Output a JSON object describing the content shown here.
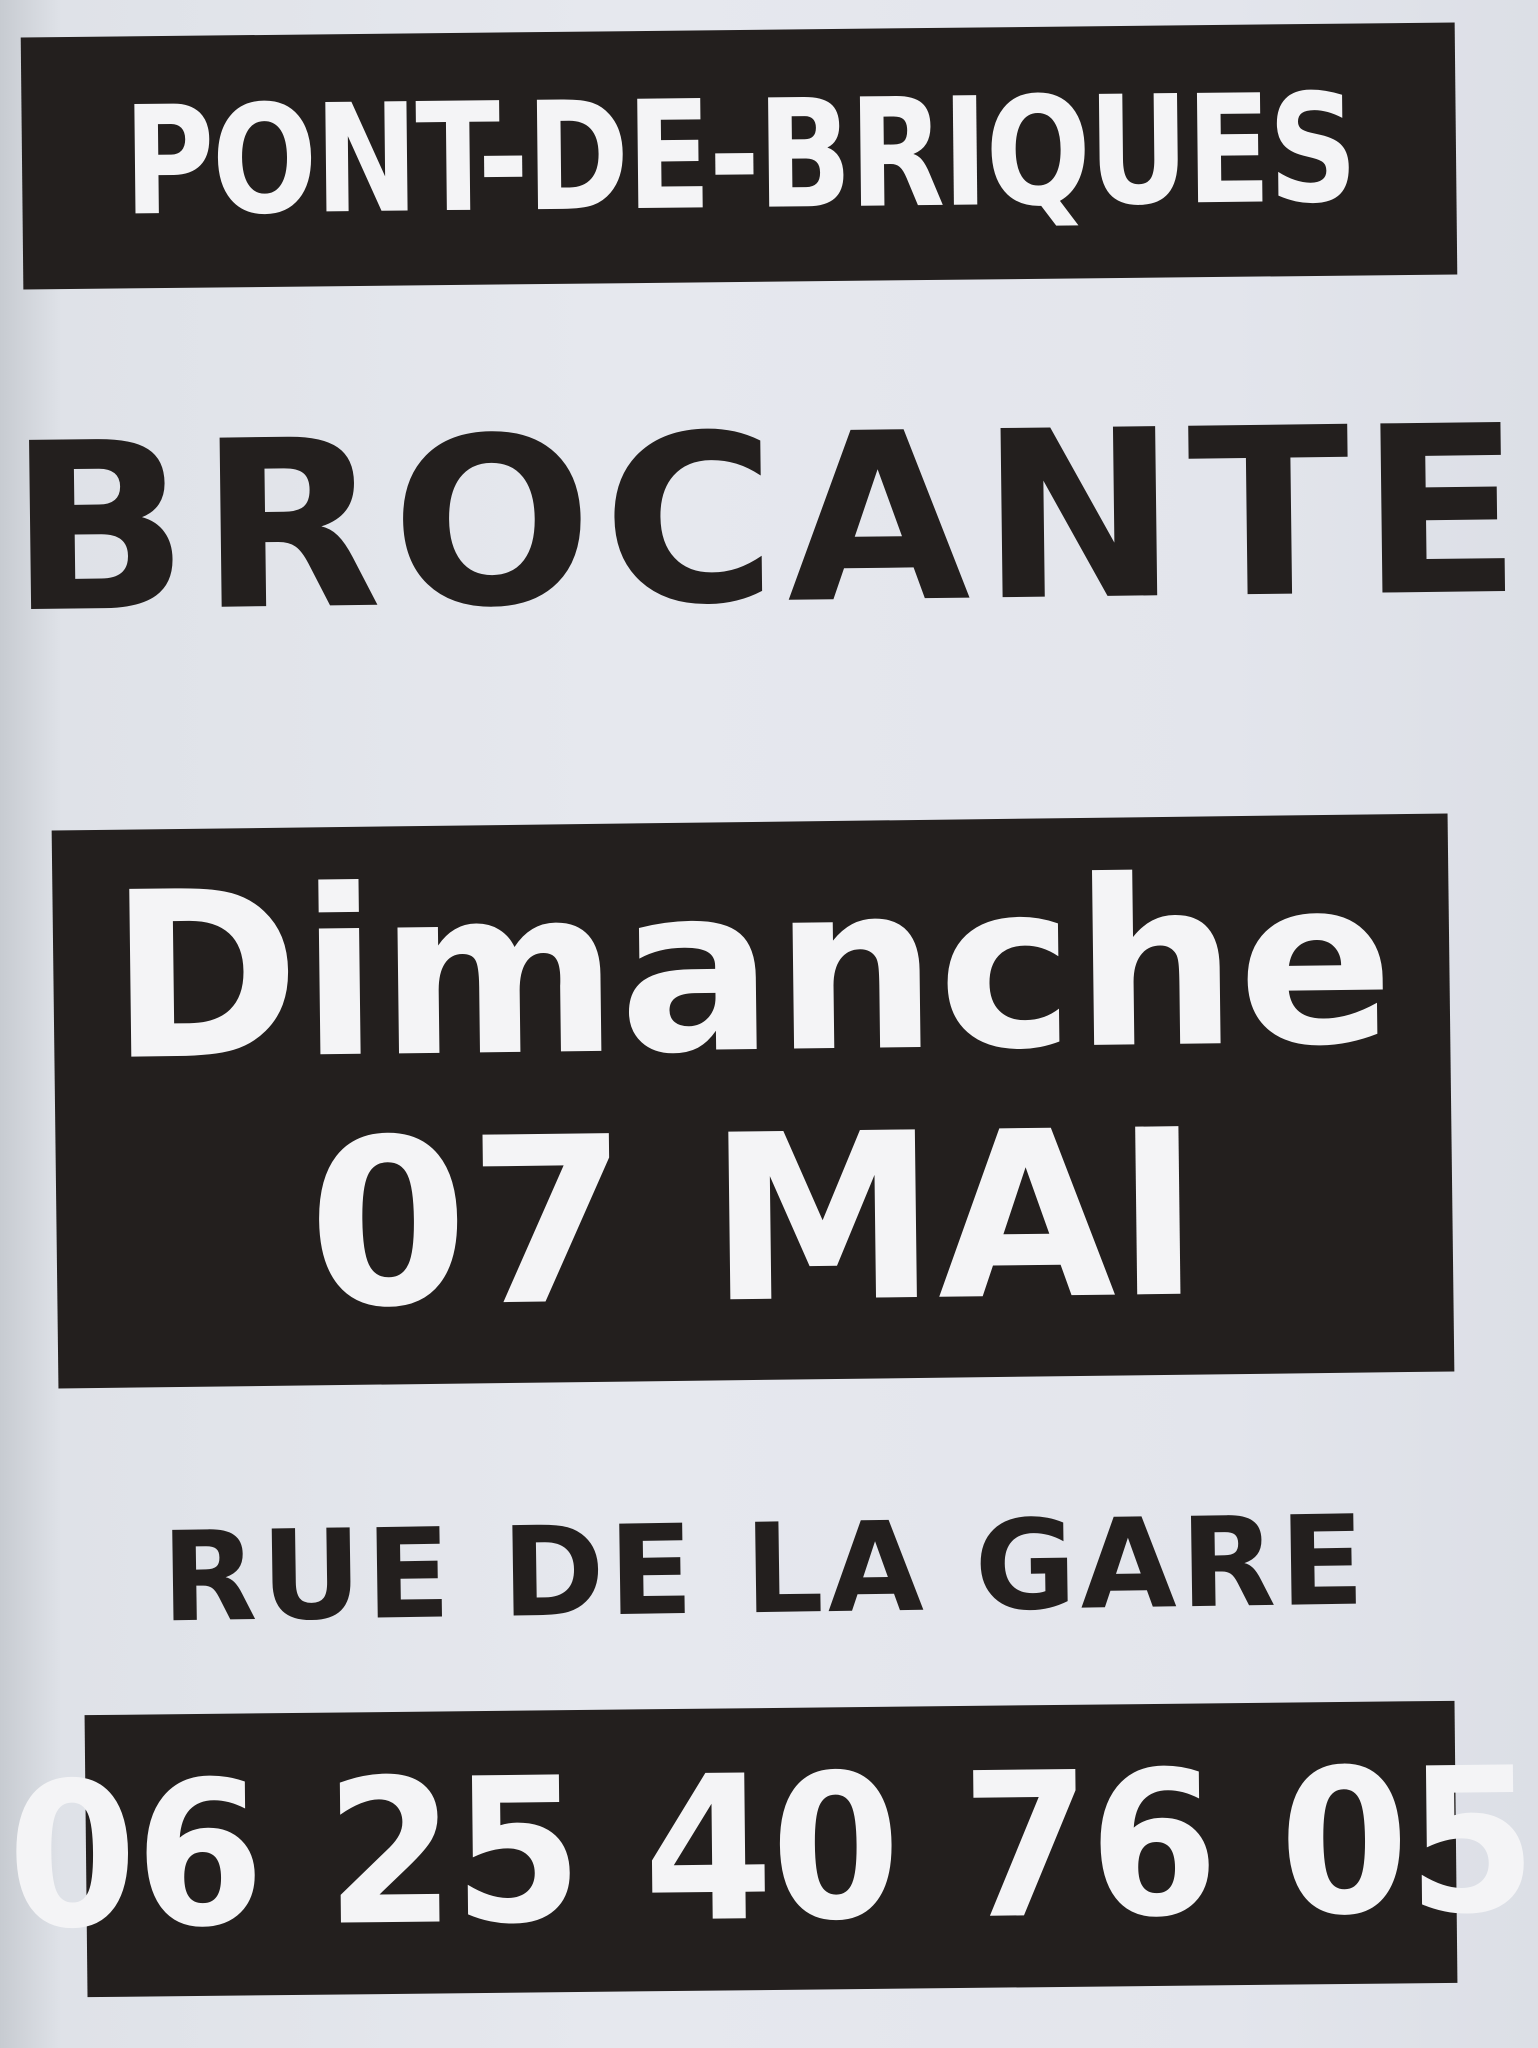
{
  "poster": {
    "town": "PONT-DE-BRIQUES",
    "headline": "BROCANTE",
    "day": "Dimanche",
    "date": "07 MAI",
    "street": "RUE DE LA GARE",
    "phone": "06 25 40 76 05"
  },
  "colors": {
    "ink": "#231f1e",
    "paper": "#e6e8ee",
    "reverse_text": "#f4f4f6"
  }
}
